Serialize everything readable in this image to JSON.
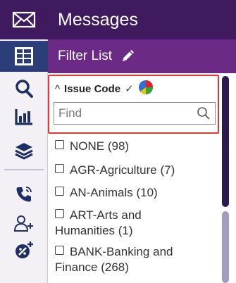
{
  "header": {
    "title": "Messages"
  },
  "filter_bar": {
    "title": "Filter List"
  },
  "rail": {
    "icons": [
      "mail-icon",
      "filter-list-icon",
      "search-icon",
      "report-chart-icon",
      "layers-icon",
      "phone-icon",
      "add-user-icon",
      "add-tag-icon"
    ],
    "active": "filter-list-icon"
  },
  "filter": {
    "field_label": "Issue Code",
    "search": {
      "placeholder": "Find",
      "value": ""
    },
    "items": [
      {
        "label": "NONE (98)"
      },
      {
        "label": "AGR-Agriculture (7)"
      },
      {
        "label": "AN-Animals (10)"
      },
      {
        "label": "ART-Arts and Humanities (1)"
      },
      {
        "label": "BANK-Banking and Finance (268)"
      }
    ]
  },
  "colors": {
    "header_bg": "#3f1a5e",
    "filter_bar_bg": "#6b2a86",
    "active_rail_bg": "#2c3e7a",
    "highlight_border": "#e53935"
  }
}
